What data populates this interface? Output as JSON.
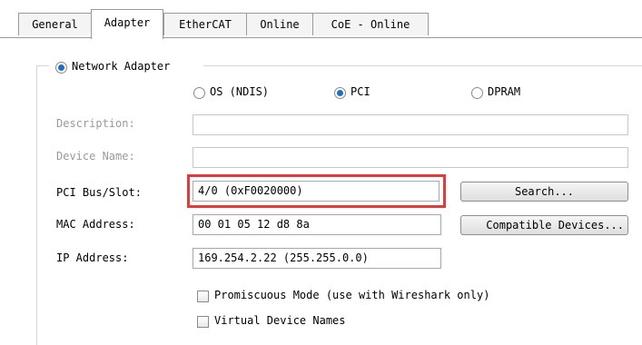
{
  "tabs": [
    {
      "label": "General",
      "active": false
    },
    {
      "label": "Adapter",
      "active": true
    },
    {
      "label": "EtherCAT",
      "active": false
    },
    {
      "label": "Online",
      "active": false
    },
    {
      "label": "CoE - Online",
      "active": false
    }
  ],
  "adapter_group": {
    "title": "Network Adapter",
    "selected": true,
    "options": [
      {
        "label": "OS (NDIS)",
        "checked": false
      },
      {
        "label": "PCI",
        "checked": true
      },
      {
        "label": "DPRAM",
        "checked": false
      }
    ]
  },
  "fields": {
    "description": {
      "label": "Description:",
      "value": ""
    },
    "device_name": {
      "label": "Device Name:",
      "value": ""
    },
    "pci_bus_slot": {
      "label": "PCI Bus/Slot:",
      "value": "4/0 (0xF0020000)"
    },
    "mac_address": {
      "label": "MAC Address:",
      "value": "00 01 05 12 d8 8a"
    },
    "ip_address": {
      "label": "IP Address:",
      "value": "169.254.2.22 (255.255.0.0)"
    }
  },
  "buttons": {
    "search": "Search...",
    "compatible_devices": "Compatible Devices..."
  },
  "checkboxes": {
    "promiscuous": {
      "label": "Promiscuous Mode (use with Wireshark only)",
      "checked": false
    },
    "virtual_names": {
      "label": "Virtual Device Names",
      "checked": false
    }
  },
  "colors": {
    "highlight": "#e53a3a",
    "radio_selected": "#1f6fc4"
  }
}
